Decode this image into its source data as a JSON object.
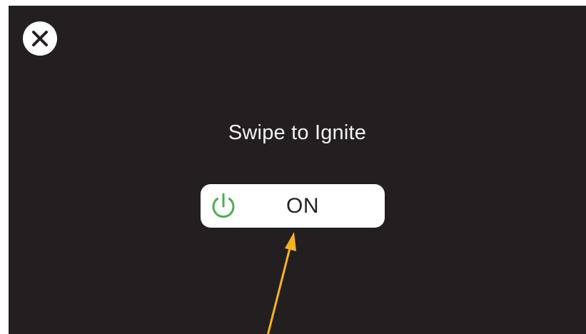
{
  "dialog": {
    "close_icon": "close-icon",
    "prompt_text": "Swipe to Ignite"
  },
  "ignite_toggle": {
    "label": "ON",
    "icon": "power-icon",
    "state": "on",
    "icon_color": "#4caf50"
  },
  "annotation": {
    "icon": "arrow-icon",
    "color": "#f4b324"
  },
  "colors": {
    "background": "#231f20",
    "text": "#f2f2f2",
    "toggle_bg": "#ffffff"
  }
}
